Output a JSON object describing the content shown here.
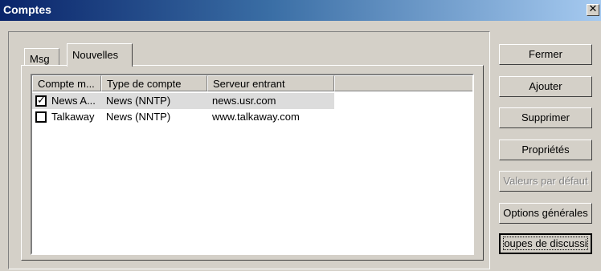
{
  "window": {
    "title": "Comptes",
    "close_glyph": "✕"
  },
  "tabs": [
    {
      "label": "Msg",
      "active": false
    },
    {
      "label": "Nouvelles",
      "active": true
    }
  ],
  "list": {
    "columns": [
      "Compte m...",
      "Type de compte",
      "Serveur entrant"
    ],
    "rows": [
      {
        "checked": true,
        "account": "News A...",
        "type": "News (NNTP)",
        "server": "news.usr.com",
        "selected": true
      },
      {
        "checked": false,
        "account": "Talkaway",
        "type": "News (NNTP)",
        "server": "www.talkaway.com",
        "selected": false
      }
    ]
  },
  "buttons": {
    "fermer": "Fermer",
    "ajouter": "Ajouter",
    "supprimer": "Supprimer",
    "proprietes": "Propriétés",
    "valeurs": "Valeurs par défaut",
    "options": "Options générales",
    "groupes": "oupes de discussi"
  },
  "checkmark": "✓"
}
